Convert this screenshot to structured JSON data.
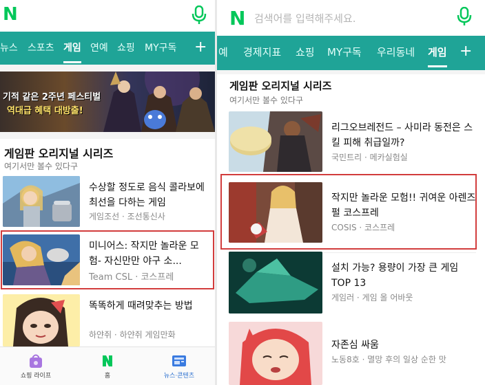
{
  "left": {
    "logo": "N",
    "nav": [
      {
        "label": "뉴스",
        "active": false
      },
      {
        "label": "스포츠",
        "active": false
      },
      {
        "label": "게임",
        "active": true
      },
      {
        "label": "연예",
        "active": false
      },
      {
        "label": "쇼핑",
        "active": false
      },
      {
        "label": "MY구독",
        "active": false
      }
    ],
    "nav_plus": "+",
    "banner": {
      "line1": "기적 같은 2주년 페스티벌",
      "line2": "역대급 혜택 대방출!"
    },
    "section_title": "게임판 오리지널 시리즈",
    "section_sub": "여기서만 볼수 있다구",
    "articles": [
      {
        "title": "수상할 정도로 음식 콜라보에 최선을 다하는 게임",
        "source": "게임조선 · 조선통신사"
      },
      {
        "title": "미니어스: 작지만 놀라운 모험- 자신만만 야구 소...",
        "source": "Team CSL · 코스프레"
      },
      {
        "title": "똑똑하게 때려맞추는 방법",
        "source": "하얀쥐 · 하얀쥐 게임만화"
      }
    ],
    "bottom_tabs": [
      {
        "label": "쇼핑 라이프",
        "active": false
      },
      {
        "label": "홈",
        "active": false
      },
      {
        "label": "뉴스·콘텐츠",
        "active": true
      }
    ]
  },
  "right": {
    "logo": "N",
    "search_placeholder": "검색어를 입력해주세요.",
    "nav": [
      {
        "label": "예",
        "active": false
      },
      {
        "label": "경제지표",
        "active": false
      },
      {
        "label": "쇼핑",
        "active": false
      },
      {
        "label": "MY구독",
        "active": false
      },
      {
        "label": "우리동네",
        "active": false
      },
      {
        "label": "게임",
        "active": true
      }
    ],
    "nav_plus": "+",
    "section_title": "게임판 오리지널 시리즈",
    "section_sub": "여기서만 볼수 있다구",
    "articles": [
      {
        "title": "리그오브레전드 – 사미라 동전은 스킬 피해 취급일까?",
        "source": "국민트리 · 메카실험실"
      },
      {
        "title": "작지만 놀라운 모험!! 귀여운 아렌즈 펄 코스프레",
        "source": "COSIS · 코스프레"
      },
      {
        "title": "설치 가능? 용량이 가장 큰 게임 TOP 13",
        "source": "게임러 · 게임 올 어바웃"
      },
      {
        "title": "자존심 싸움",
        "source": "노동8호 · 멸망 후의 일상 순한 맛"
      }
    ]
  },
  "colors": {
    "brand_green": "#03c75a",
    "nav_teal": "#1fa497",
    "highlight_red": "#d23c3c"
  },
  "icons": [
    "microphone-icon",
    "shopping-bag-icon",
    "naver-home-icon",
    "news-icon"
  ]
}
